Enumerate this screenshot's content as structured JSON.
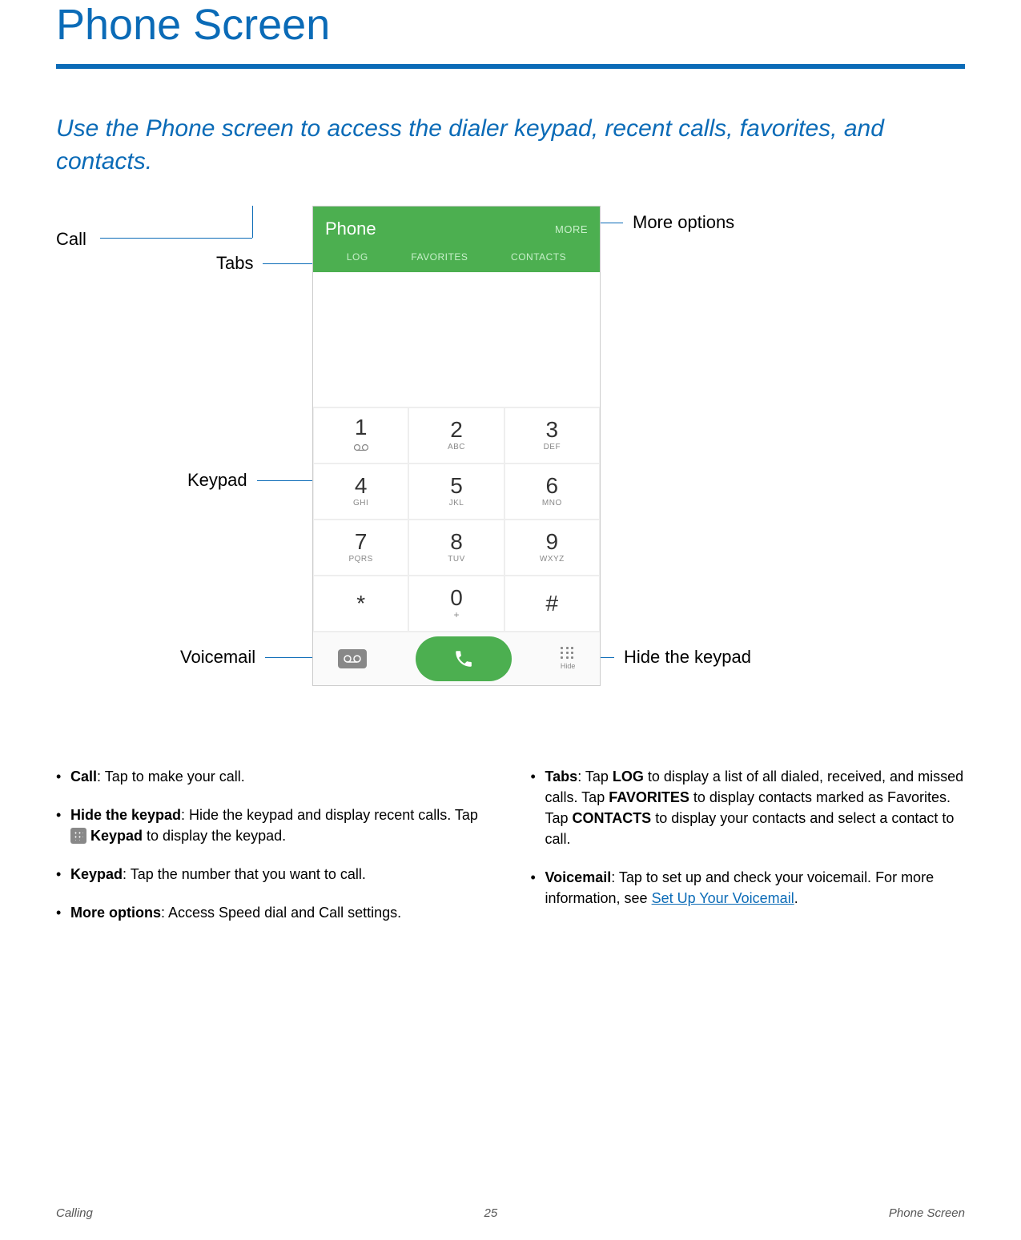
{
  "page": {
    "title": "Phone Screen",
    "intro": "Use the Phone screen to access the dialer keypad, recent calls, favorites, and contacts."
  },
  "phone": {
    "app_title": "Phone",
    "more": "MORE",
    "tabs": [
      "LOG",
      "FAVORITES",
      "CONTACTS"
    ],
    "keys": [
      {
        "digit": "1",
        "sub": "voicemail-icon"
      },
      {
        "digit": "2",
        "sub": "ABC"
      },
      {
        "digit": "3",
        "sub": "DEF"
      },
      {
        "digit": "4",
        "sub": "GHI"
      },
      {
        "digit": "5",
        "sub": "JKL"
      },
      {
        "digit": "6",
        "sub": "MNO"
      },
      {
        "digit": "7",
        "sub": "PQRS"
      },
      {
        "digit": "8",
        "sub": "TUV"
      },
      {
        "digit": "9",
        "sub": "WXYZ"
      },
      {
        "digit": "*",
        "sub": ""
      },
      {
        "digit": "0",
        "sub": "+"
      },
      {
        "digit": "#",
        "sub": ""
      }
    ],
    "hide_label": "Hide"
  },
  "callouts": {
    "more": "More options",
    "tabs": "Tabs",
    "keypad": "Keypad",
    "voicemail": "Voicemail",
    "hide": "Hide the keypad",
    "call": "Call"
  },
  "bullets_left": {
    "b0_label": "Call",
    "b0_text": ": Tap to make your call.",
    "b1_label": "Hide the keypad",
    "b1_text_a": ": Hide the keypad and display recent calls. Tap ",
    "b1_text_b": "Keypad",
    "b1_text_c": " to display the keypad.",
    "b2_label": "Keypad",
    "b2_text": ": Tap the number that you want to call.",
    "b3_label": "More options",
    "b3_text": ": Access Speed dial and Call settings."
  },
  "bullets_right": {
    "b0_label": "Tabs",
    "b0_a": ": Tap ",
    "b0_b": "LOG",
    "b0_c": " to display a list of all dialed, received, and missed calls. Tap ",
    "b0_d": "FAVORITES",
    "b0_e": " to display contacts marked as Favorites. Tap ",
    "b0_f": "CONTACTS",
    "b0_g": " to display your contacts and select a contact to call.",
    "b1_label": "Voicemail",
    "b1_text": ": Tap to set up and check your voicemail. For more information, see ",
    "b1_link": "Set Up Your Voicemail",
    "b1_end": "."
  },
  "footer": {
    "left": "Calling",
    "center": "25",
    "right": "Phone Screen"
  }
}
